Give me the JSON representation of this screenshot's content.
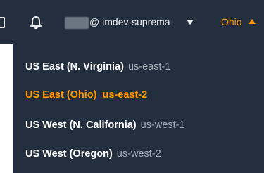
{
  "topbar": {
    "account_label": "@ imdev-suprema",
    "current_region": "Ohio",
    "icons": [
      "monitor-icon",
      "bell-icon",
      "caret-down-icon",
      "caret-up-icon"
    ]
  },
  "regions": [
    {
      "name": "US East (N. Virginia)",
      "code": "us-east-1",
      "selected": false
    },
    {
      "name": "US East (Ohio)",
      "code": "us-east-2",
      "selected": true
    },
    {
      "name": "US West (N. California)",
      "code": "us-west-1",
      "selected": false
    },
    {
      "name": "US West (Oregon)",
      "code": "us-west-2",
      "selected": false
    }
  ],
  "colors": {
    "header_bg": "#232f3e",
    "accent": "#ff9900",
    "text": "#ffffff",
    "muted": "#a7b0ba"
  }
}
